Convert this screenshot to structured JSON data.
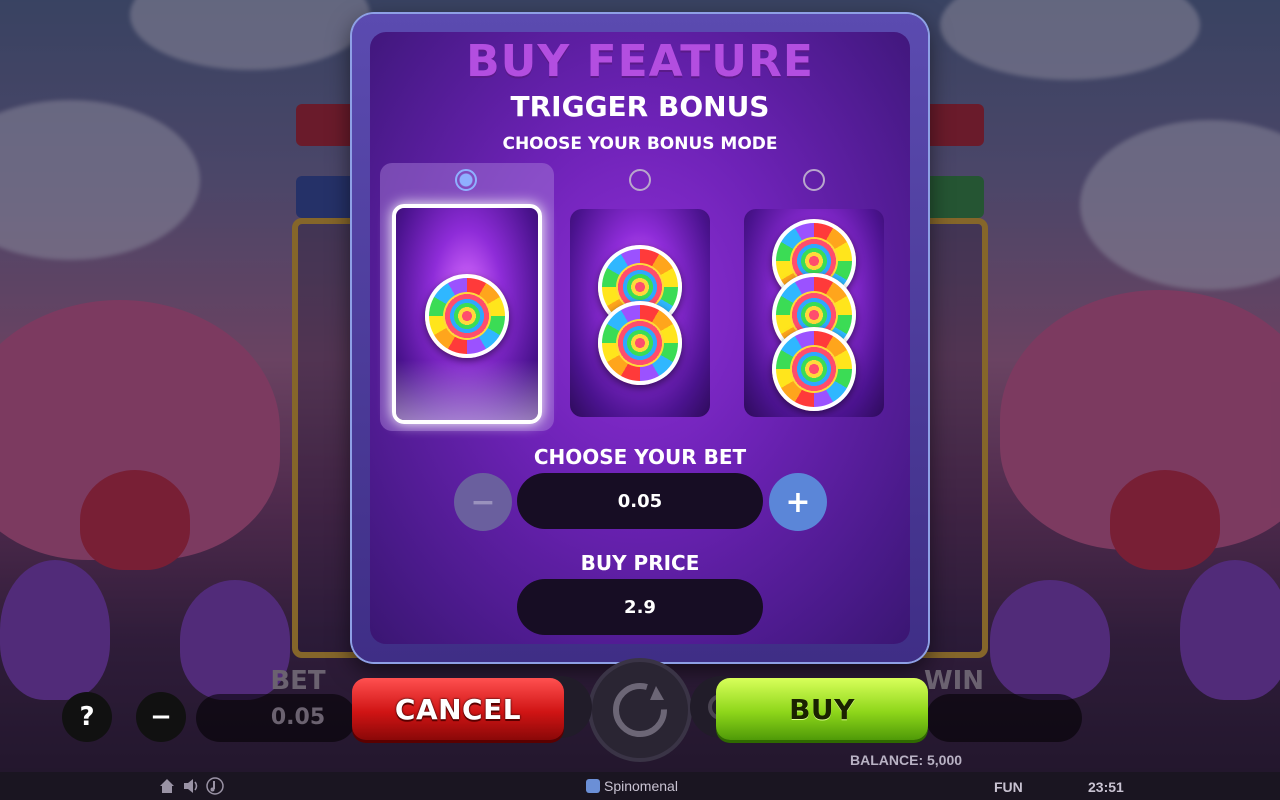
{
  "modal": {
    "title": "BUY FEATURE",
    "subtitle": "TRIGGER BONUS",
    "mode_prompt": "CHOOSE YOUR BONUS MODE",
    "modes": [
      {
        "selected": true
      },
      {
        "selected": false
      },
      {
        "selected": false
      }
    ],
    "bet_label": "CHOOSE YOUR BET",
    "bet_value": "0.05",
    "minus_label": "−",
    "plus_label": "+",
    "price_label": "BUY PRICE",
    "price_value": "2.9"
  },
  "buttons": {
    "cancel": "CANCEL",
    "buy": "BUY"
  },
  "hud": {
    "help": "?",
    "minus": "−",
    "bet_label": "BET",
    "bet_value": "0.05",
    "win_label": "WIN",
    "balance": "BALANCE: 5,000"
  },
  "footer": {
    "brand": "Spinomenal",
    "mode": "FUN",
    "time": "23:51"
  },
  "colors": {
    "title": "#b34ee0",
    "cancel": "#d01414",
    "buy": "#8ed61a",
    "radio_selected": "#8fb0ff"
  }
}
